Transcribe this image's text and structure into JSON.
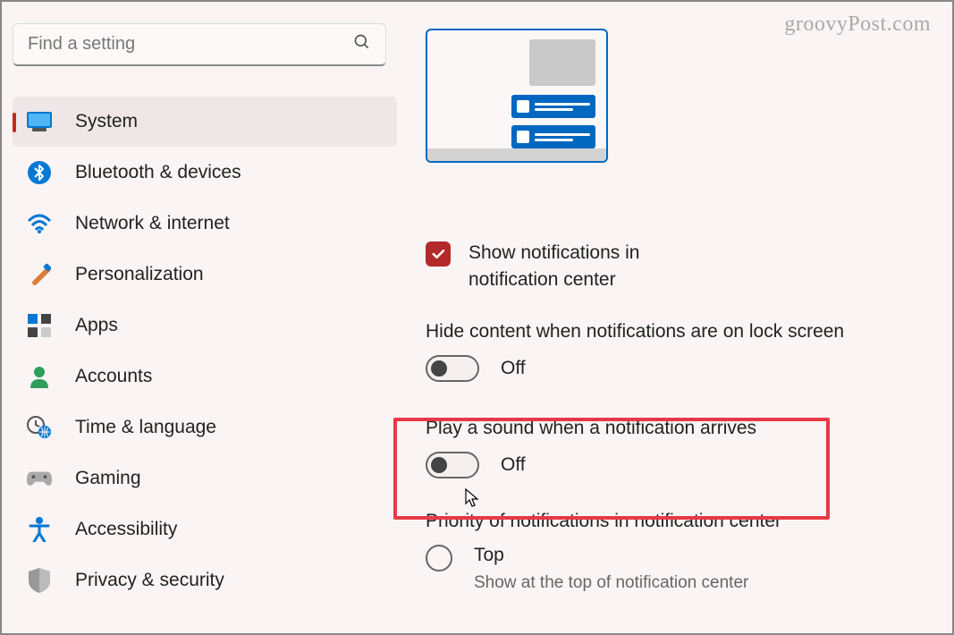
{
  "watermark": "groovyPost.com",
  "search": {
    "placeholder": "Find a setting"
  },
  "sidebar": {
    "items": [
      {
        "label": "System"
      },
      {
        "label": "Bluetooth & devices"
      },
      {
        "label": "Network & internet"
      },
      {
        "label": "Personalization"
      },
      {
        "label": "Apps"
      },
      {
        "label": "Accounts"
      },
      {
        "label": "Time & language"
      },
      {
        "label": "Gaming"
      },
      {
        "label": "Accessibility"
      },
      {
        "label": "Privacy & security"
      }
    ]
  },
  "main": {
    "show_notifications": {
      "line1": "Show notifications in",
      "line2": "notification center"
    },
    "hide_content": {
      "title": "Hide content when notifications are on lock screen",
      "state": "Off"
    },
    "play_sound": {
      "title": "Play a sound when a notification arrives",
      "state": "Off"
    },
    "priority": {
      "title": "Priority of notifications in notification center",
      "option_label": "Top",
      "option_desc": "Show at the top of notification center"
    }
  }
}
